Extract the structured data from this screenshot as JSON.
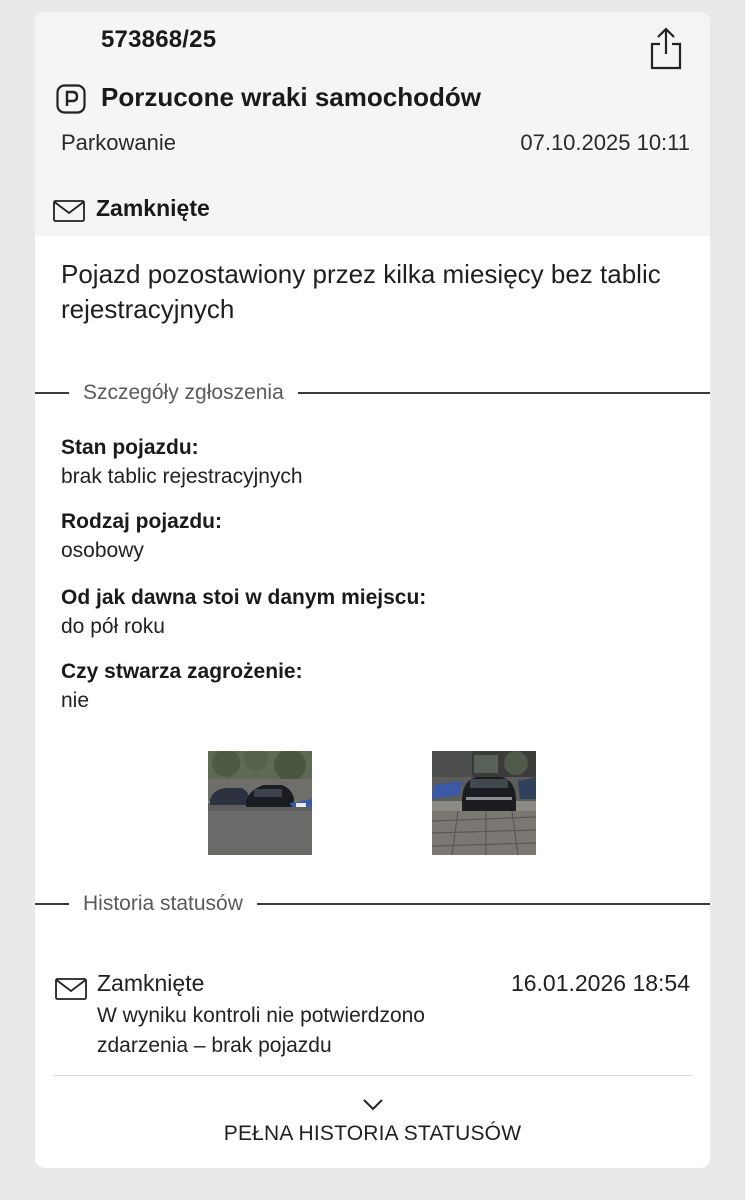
{
  "report": {
    "number": "573868/25",
    "title": "Porzucone wraki samochodów",
    "category": "Parkowanie",
    "created": "07.10.2025 10:11",
    "status": "Zamknięte",
    "description": "Pojazd pozostawiony przez kilka miesięcy bez tablic rejestracyjnych",
    "icons": {
      "share": "share-icon",
      "category": "parking-icon",
      "status": "envelope-icon"
    }
  },
  "details": {
    "heading": "Szczegóły zgłoszenia",
    "fields": [
      {
        "label": "Stan pojazdu:",
        "value": "brak tablic rejestracyjnych"
      },
      {
        "label": "Rodzaj pojazdu:",
        "value": "osobowy"
      },
      {
        "label": "Od jak dawna stoi w danym miejscu:",
        "value": "do pół roku"
      },
      {
        "label": "Czy stwarza zagrożenie:",
        "value": "nie"
      }
    ],
    "photos": [
      "photo-parked-cars",
      "photo-dark-suv-front"
    ]
  },
  "history": {
    "heading": "Historia statusów",
    "entries": [
      {
        "status": "Zamknięte",
        "date": "16.01.2026 18:54",
        "comment": "W wyniku kontroli nie potwierdzono zdarzenia – brak pojazdu"
      }
    ],
    "expand_label": "PEŁNA HISTORIA STATUSÓW"
  },
  "colors": {
    "background": "#e9e9ea",
    "card": "#ffffff",
    "header": "#f5f5f5",
    "text": "#1a1a1a",
    "muted": "#5a5a5a"
  }
}
